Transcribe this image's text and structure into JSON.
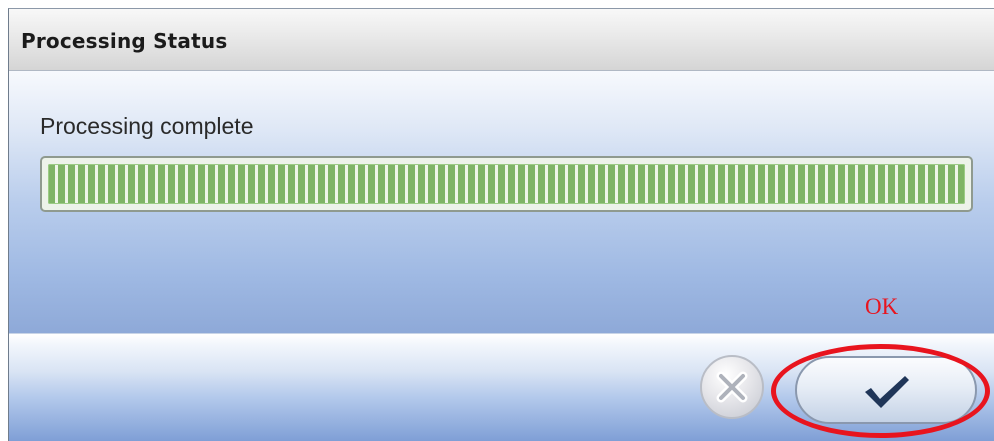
{
  "dialog": {
    "title": "Processing Status",
    "status_text": "Processing complete",
    "progress_percent": 100
  },
  "buttons": {
    "cancel_icon": "close-icon",
    "ok_icon": "checkmark-icon"
  },
  "annotation": {
    "label": "OK",
    "color": "#e8141e"
  },
  "colors": {
    "progress_fill": "#7fb466",
    "dialog_gradient_bottom": "#8ea9d8"
  }
}
